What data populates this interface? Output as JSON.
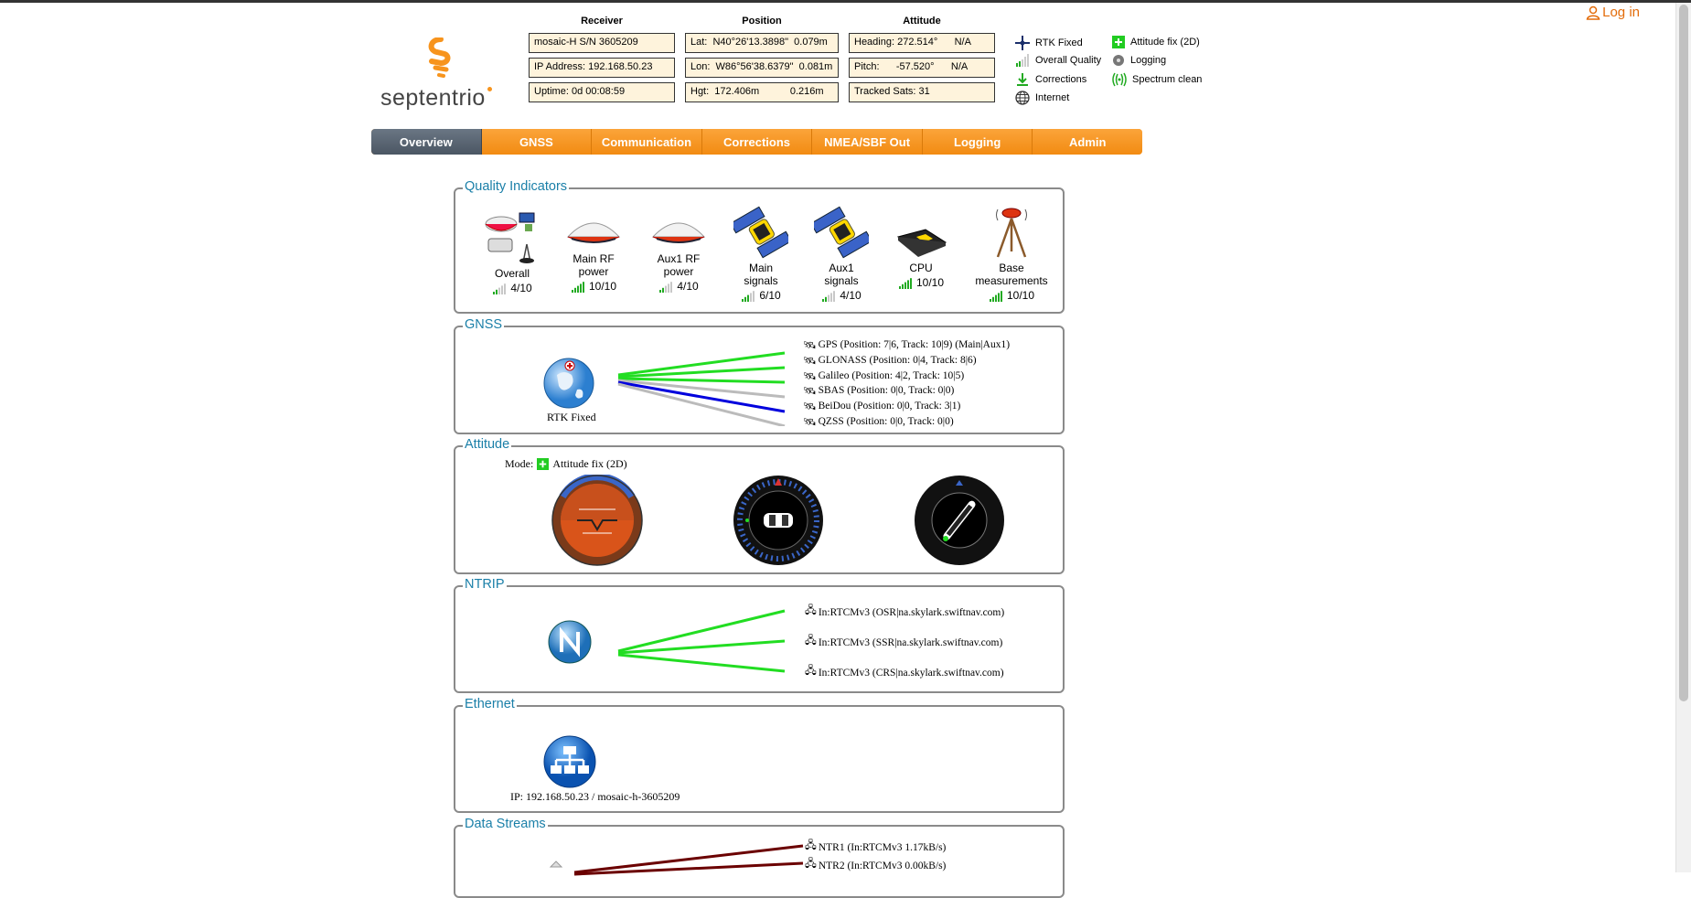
{
  "header": {
    "login_label": "Log in",
    "logo_text": "septentrio"
  },
  "status": {
    "receiver": {
      "heading": "Receiver",
      "model": "mosaic-H S/N 3605209",
      "ip": "IP Address: 192.168.50.23",
      "uptime": "Uptime: 0d 00:08:59"
    },
    "position": {
      "heading": "Position",
      "lat": "Lat:  N40°26'13.3898\"  0.079m",
      "lon": "Lon:  W86°56'38.6379\"  0.081m",
      "hgt": "Hgt:  172.406m           0.216m"
    },
    "attitude": {
      "heading": "Attitude",
      "heading_val": "Heading: 272.514°      N/A",
      "pitch": "Pitch:      -57.520°      N/A",
      "sats": "Tracked Sats: 31"
    }
  },
  "legend": {
    "rtk": "RTK Fixed",
    "quality": "Overall Quality",
    "corrections": "Corrections",
    "internet": "Internet",
    "attitude_fix": "Attitude fix (2D)",
    "logging": "Logging",
    "spectrum": "Spectrum clean"
  },
  "nav": {
    "tabs": [
      "Overview",
      "GNSS",
      "Communication",
      "Corrections",
      "NMEA/SBF Out",
      "Logging",
      "Admin"
    ]
  },
  "quality": {
    "title": "Quality Indicators",
    "items": [
      {
        "label1": "Overall",
        "label2": "",
        "score": "4/10",
        "level": 4
      },
      {
        "label1": "Main RF",
        "label2": "power",
        "score": "10/10",
        "level": 10
      },
      {
        "label1": "Aux1 RF",
        "label2": "power",
        "score": "4/10",
        "level": 4
      },
      {
        "label1": "Main",
        "label2": "signals",
        "score": "6/10",
        "level": 6
      },
      {
        "label1": "Aux1",
        "label2": "signals",
        "score": "4/10",
        "level": 4
      },
      {
        "label1": "CPU",
        "label2": "",
        "score": "10/10",
        "level": 10
      },
      {
        "label1": "Base",
        "label2": "measurements",
        "score": "10/10",
        "level": 10
      }
    ]
  },
  "gnss": {
    "title": "GNSS",
    "fix_label": "RTK Fixed",
    "constellations": [
      "GPS (Position: 7|6, Track: 10|9) (Main|Aux1)",
      "GLONASS (Position: 0|4, Track: 8|6)",
      "Galileo (Position: 4|2, Track: 10|5)",
      "SBAS (Position: 0|0, Track: 0|0)",
      "BeiDou (Position: 0|0, Track: 3|1)",
      "QZSS (Position: 0|0, Track: 0|0)"
    ]
  },
  "attitude_panel": {
    "title": "Attitude",
    "mode_label": "Mode:",
    "mode_value": "Attitude fix (2D)"
  },
  "ntrip": {
    "title": "NTRIP",
    "streams": [
      "In:RTCMv3 (OSR|na.skylark.swiftnav.com)",
      "In:RTCMv3 (SSR|na.skylark.swiftnav.com)",
      "In:RTCMv3 (CRS|na.skylark.swiftnav.com)"
    ]
  },
  "ethernet": {
    "title": "Ethernet",
    "ip_label": "IP: 192.168.50.23 / mosaic-h-3605209"
  },
  "data_streams": {
    "title": "Data Streams",
    "streams": [
      "NTR1 (In:RTCMv3 1.17kB/s)",
      "NTR2 (In:RTCMv3 0.00kB/s)"
    ]
  },
  "colors": {
    "orange": "#f7941d",
    "title_blue": "#1a7fa8",
    "signal_green": "#22dd22",
    "link_blue": "#0000dd",
    "link_gray": "#bbbbbb",
    "stream_dark": "#6b0000"
  }
}
